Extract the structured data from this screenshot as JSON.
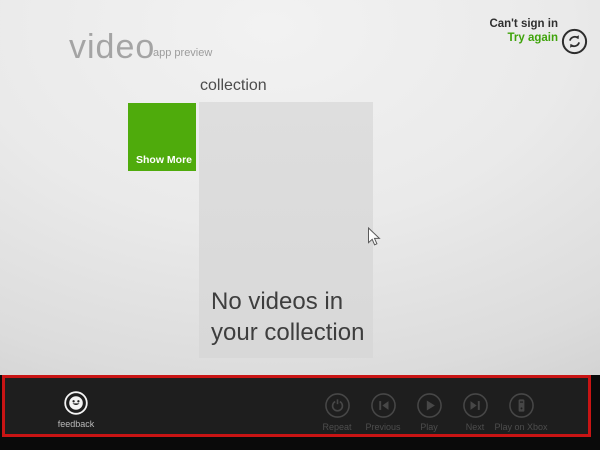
{
  "header": {
    "app_title": "video",
    "app_subtitle": "app preview",
    "signin": {
      "status": "Can't sign in",
      "action": "Try again",
      "icon": "sync-icon"
    }
  },
  "main": {
    "section_label": "collection",
    "show_more_tile": {
      "label": "Show More",
      "color": "#4FAB0C"
    },
    "empty_tile": {
      "line1": "No videos in",
      "line2": "your collection"
    }
  },
  "appbar": {
    "feedback": {
      "label": "feedback",
      "icon": "smiley-icon"
    },
    "controls": [
      {
        "label": "Repeat",
        "icon": "repeat-icon",
        "enabled": false
      },
      {
        "label": "Previous",
        "icon": "previous-icon",
        "enabled": false
      },
      {
        "label": "Play",
        "icon": "play-icon",
        "enabled": false
      },
      {
        "label": "Next",
        "icon": "next-icon",
        "enabled": false
      },
      {
        "label": "Play on Xbox",
        "icon": "play-on-xbox-icon",
        "enabled": false
      }
    ]
  },
  "annotation": {
    "highlight_color": "#C81414"
  },
  "colors": {
    "accent_green": "#4FAB0C",
    "action_green": "#3FA30B",
    "appbar_bg": "#1E1E1E",
    "tile_gray": "#DCDCDC",
    "disabled_icon": "#474747"
  }
}
